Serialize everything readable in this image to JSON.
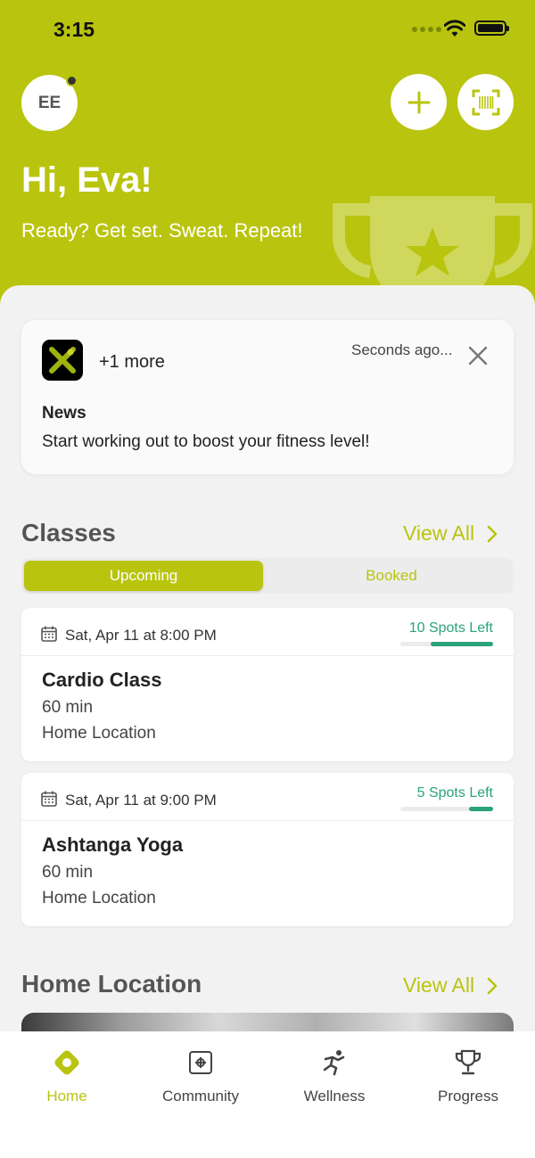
{
  "status_bar": {
    "time": "3:15"
  },
  "header": {
    "avatar_initials": "EE",
    "greeting": "Hi, Eva!",
    "tagline": "Ready? Get set. Sweat. Repeat!"
  },
  "news": {
    "more_label": "+1 more",
    "time_ago": "Seconds ago...",
    "title": "News",
    "body": "Start working out to boost your fitness level!"
  },
  "classes": {
    "title": "Classes",
    "view_all": "View All",
    "tabs": {
      "upcoming": "Upcoming",
      "booked": "Booked"
    },
    "items": [
      {
        "date": "Sat, Apr 11 at 8:00 PM",
        "spots": "10 Spots Left",
        "spots_fraction": 0.67,
        "name": "Cardio Class",
        "duration": "60 min",
        "location": "Home Location"
      },
      {
        "date": "Sat, Apr 11 at 9:00 PM",
        "spots": "5 Spots Left",
        "spots_fraction": 0.26,
        "name": "Ashtanga Yoga",
        "duration": "60 min",
        "location": "Home Location"
      }
    ]
  },
  "home_location": {
    "title": "Home Location",
    "view_all": "View All"
  },
  "tab_bar": {
    "home": "Home",
    "community": "Community",
    "wellness": "Wellness",
    "progress": "Progress"
  },
  "colors": {
    "accent": "#b9c40f",
    "spots": "#2aa27a"
  }
}
